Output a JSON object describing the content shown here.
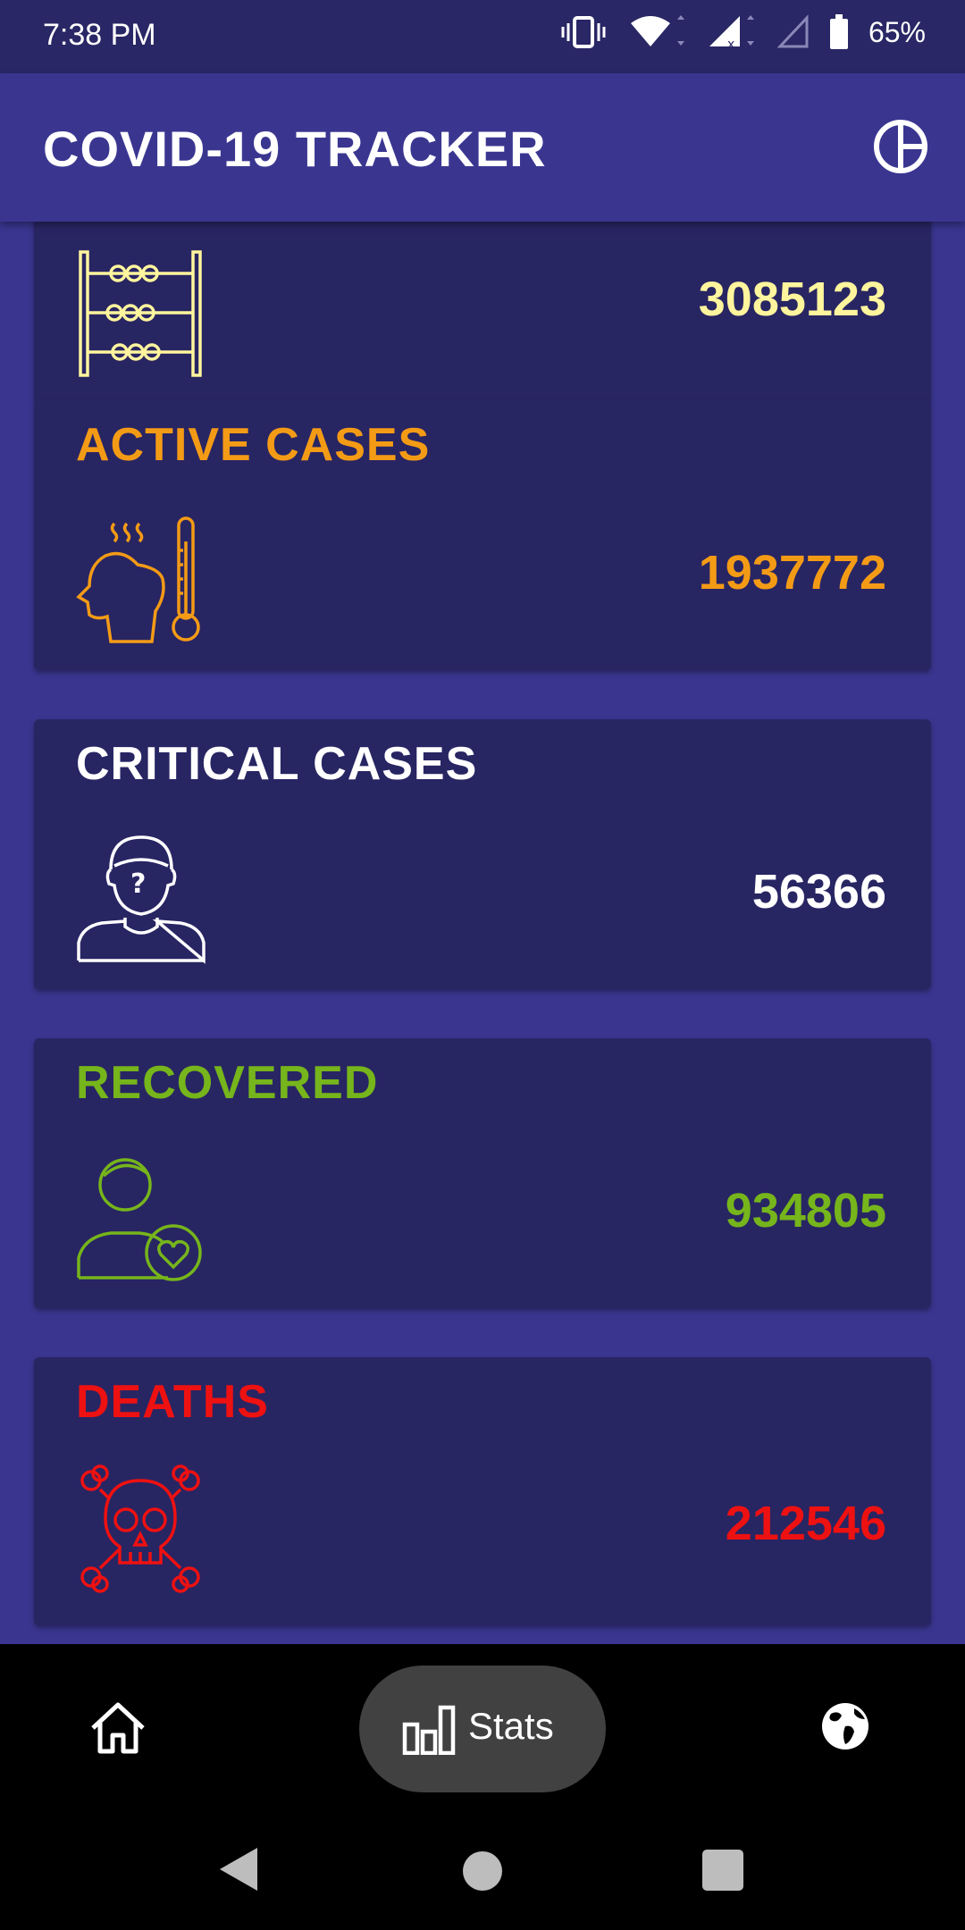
{
  "status_bar": {
    "time": "7:38 PM",
    "battery": "65%"
  },
  "app_bar": {
    "title": "COVID-19 TRACKER",
    "action_icon": "pie-chart-icon"
  },
  "cards": [
    {
      "id": "total",
      "label": "",
      "value": "3085123",
      "color": "#fff59d",
      "icon": "abacus-icon"
    },
    {
      "id": "active",
      "label": "ACTIVE CASES",
      "value": "1937772",
      "color": "#f49b16",
      "icon": "fever-thermometer-icon"
    },
    {
      "id": "critical",
      "label": "CRITICAL CASES",
      "value": "56366",
      "color": "#ffffff",
      "icon": "patient-question-icon"
    },
    {
      "id": "recovered",
      "label": "RECOVERED",
      "value": "934805",
      "color": "#76b51b",
      "icon": "person-heart-icon"
    },
    {
      "id": "deaths",
      "label": "DEATHS",
      "value": "212546",
      "color": "#ee1111",
      "icon": "skull-crossbones-icon"
    }
  ],
  "bottom_nav": {
    "items": [
      {
        "id": "home",
        "label": "",
        "icon": "home-icon"
      },
      {
        "id": "stats",
        "label": "Stats",
        "icon": "bar-chart-icon",
        "selected": true
      },
      {
        "id": "world",
        "label": "",
        "icon": "globe-icon"
      }
    ]
  },
  "system_nav": [
    "back",
    "home",
    "recents"
  ]
}
